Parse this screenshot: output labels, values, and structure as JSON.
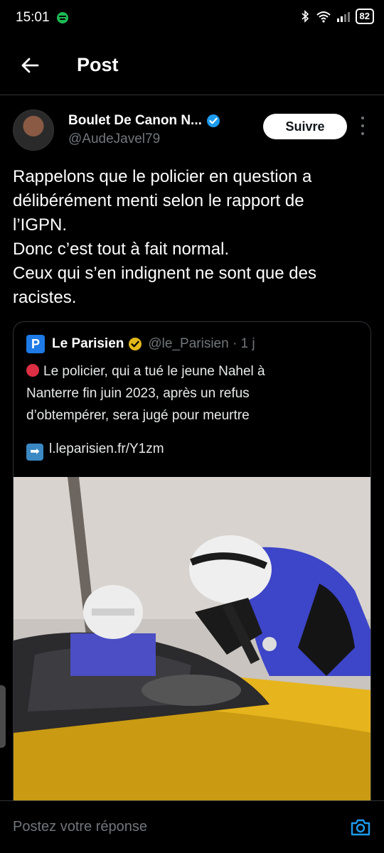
{
  "status_bar": {
    "time": "15:01",
    "battery": "82",
    "icons": [
      "spotify-icon",
      "bluetooth-icon",
      "wifi-icon",
      "signal-icon",
      "battery-icon"
    ]
  },
  "header": {
    "title": "Post",
    "back_icon": "back-arrow-icon"
  },
  "post": {
    "author_name": "Boulet De Canon N...",
    "author_handle": "@AudeJavel79",
    "follow_label": "Suivre",
    "text_lines": [
      "Rappelons que le policier en question a",
      "délibérément menti selon le rapport de",
      "l’IGPN.",
      "Donc c’est tout à fait normal.",
      "Ceux qui s’en indignent ne sont que des",
      "racistes."
    ]
  },
  "quote": {
    "logo_letter": "P",
    "name": "Le Parisien",
    "handle_time": "@le_Parisien · 1 j",
    "text_lines": [
      "Le policier, qui a tué le jeune Nahel à",
      "Nanterre fin juin 2023, après un refus",
      "d’obtempérer, sera jugé pour meurtre"
    ],
    "link": "l.leparisien.fr/Y1zm",
    "link_icon": "➡"
  },
  "reply": {
    "placeholder": "Postez votre réponse"
  },
  "colors": {
    "background": "#000000",
    "accent": "#1d9bf0",
    "gold_badge": "#e2b719",
    "muted": "#71767b"
  }
}
